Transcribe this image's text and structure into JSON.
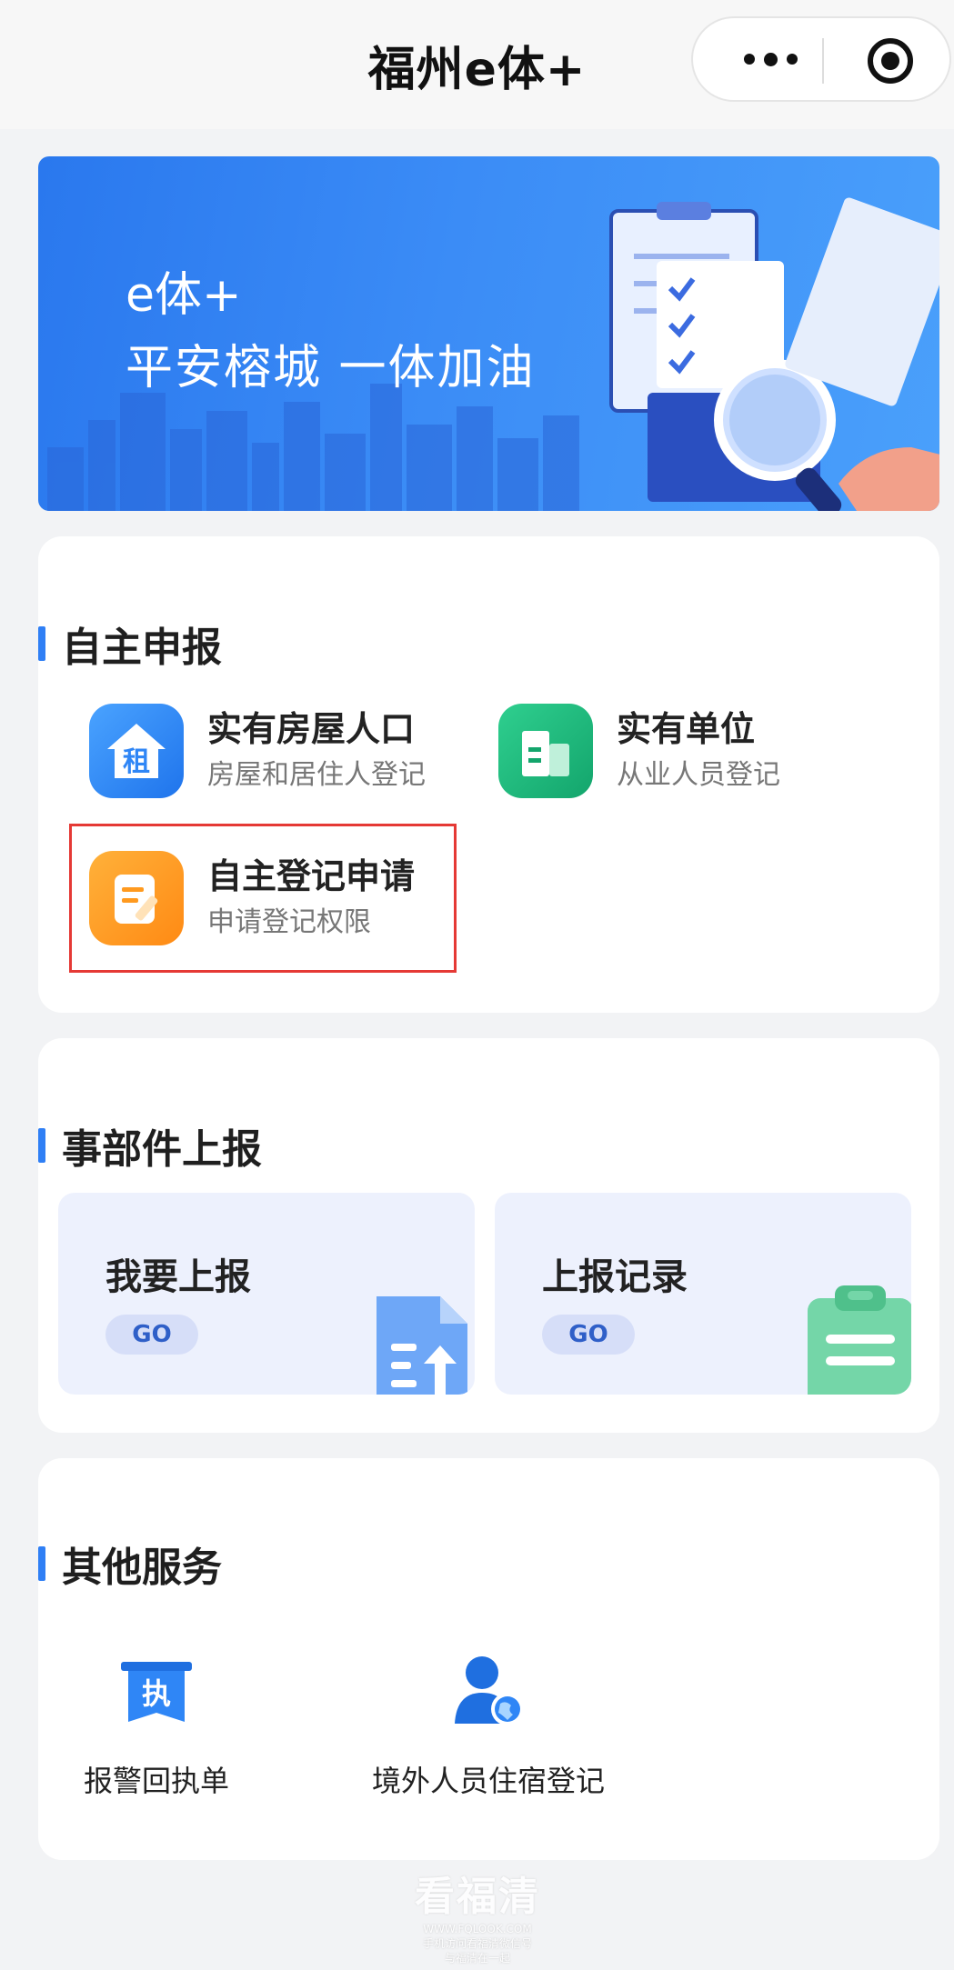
{
  "header": {
    "title": "福州e体+"
  },
  "banner": {
    "title": "e体+",
    "subtitle": "平安榕城 一体加油"
  },
  "self_report": {
    "section_title": "自主申报",
    "items": [
      {
        "name": "实有房屋人口",
        "desc": "房屋和居住人登记",
        "icon": "rent-house-icon",
        "icon_glyph": "租",
        "color": "#2f86f6"
      },
      {
        "name": "实有单位",
        "desc": "从业人员登记",
        "icon": "building-icon",
        "color": "#19b37a"
      },
      {
        "name": "自主登记申请",
        "desc": "申请登记权限",
        "icon": "edit-form-icon",
        "color": "#ff9a1f"
      }
    ]
  },
  "incident_report": {
    "section_title": "事部件上报",
    "tiles": [
      {
        "name": "我要上报",
        "go": "GO",
        "icon": "upload-document-icon"
      },
      {
        "name": "上报记录",
        "go": "GO",
        "icon": "clipboard-icon"
      }
    ]
  },
  "other_services": {
    "section_title": "其他服务",
    "items": [
      {
        "label": "报警回执单",
        "icon": "receipt-icon",
        "icon_glyph": "执"
      },
      {
        "label": "境外人员住宿登记",
        "icon": "foreigner-globe-icon"
      }
    ]
  },
  "watermark": {
    "text": "看福清",
    "url": "WWW.FQLOOK.COM",
    "line1": "手机访问看福清微信号",
    "line2": "与福清在一起"
  }
}
